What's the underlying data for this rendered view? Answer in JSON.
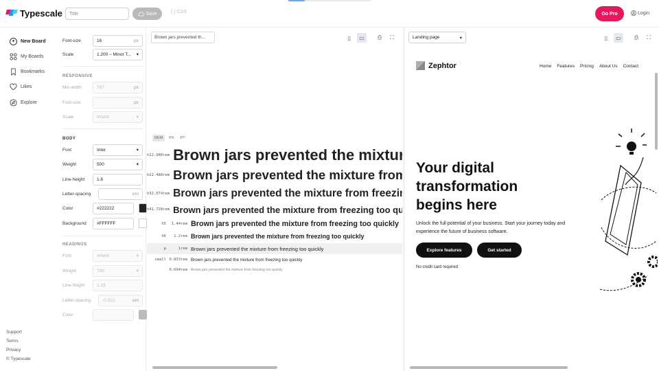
{
  "topbar": {
    "app_name": "Typescale",
    "title_placeholder": "Title",
    "save_label": "Save",
    "css_label": "CSS",
    "gopro_label": "Go Pro",
    "login_label": "Login",
    "brand_color": "#e5185e"
  },
  "sidenav": {
    "items": [
      {
        "label": "New Board",
        "icon": "plus-circle-icon"
      },
      {
        "label": "My Boards",
        "icon": "grid-icon"
      },
      {
        "label": "Bookmarks",
        "icon": "bookmark-icon"
      },
      {
        "label": "Likes",
        "icon": "heart-icon"
      },
      {
        "label": "Explore",
        "icon": "compass-icon"
      }
    ],
    "footer": [
      "Support",
      "Terms",
      "Privacy",
      "© Typescale"
    ]
  },
  "settings": {
    "font_size": {
      "label": "Font-size",
      "value": "16",
      "unit": "px"
    },
    "scale": {
      "label": "Scale",
      "value": "1.200 – Minor T..."
    },
    "responsive": {
      "heading": "RESPONSIVE",
      "min_width": {
        "label": "Min-width",
        "value": "767",
        "unit": "px"
      },
      "font_size": {
        "label": "Font-size",
        "value": "",
        "unit": "px"
      },
      "scale": {
        "label": "Scale",
        "value": "Inherit"
      }
    },
    "body": {
      "heading": "BODY",
      "font": {
        "label": "Font",
        "value": "Inter"
      },
      "weight": {
        "label": "Weight",
        "value": "500"
      },
      "line_height": {
        "label": "Line-height",
        "value": "1.6"
      },
      "letter_spacing": {
        "label": "Letter-spacing",
        "value": "",
        "unit": "em"
      },
      "color": {
        "label": "Color",
        "value": "#222222"
      },
      "background": {
        "label": "Background",
        "value": "#FFFFFF"
      }
    },
    "headings": {
      "heading": "HEADINGS",
      "font": {
        "label": "Font",
        "value": "Inherit"
      },
      "weight": {
        "label": "Weight",
        "value": "700"
      },
      "line_height": {
        "label": "Line-height",
        "value": "1.15"
      },
      "letter_spacing": {
        "label": "Letter-spacing",
        "value": "-0.022",
        "unit": "em"
      },
      "color": {
        "label": "Color",
        "value": ""
      }
    }
  },
  "preview": {
    "sample_text": "Brown jars prevented th...",
    "unit_tabs": [
      "REM",
      "PX",
      "PT"
    ],
    "active_unit": "REM",
    "rows": [
      {
        "tag": "h1",
        "rem": "2.986rem",
        "text": "Brown jars prevented the mixture from freezing too quickly"
      },
      {
        "tag": "h2",
        "rem": "2.488rem",
        "text": "Brown jars prevented the mixture from freezing too quickly"
      },
      {
        "tag": "h3",
        "rem": "2.074rem",
        "text": "Brown jars prevented the mixture from freezing too quickly"
      },
      {
        "tag": "h4",
        "rem": "1.728rem",
        "text": "Brown jars prevented the mixture from freezing too quickly"
      },
      {
        "tag": "h5",
        "rem": "1.44rem",
        "text": "Brown jars prevented the mixture from freezing too quickly"
      },
      {
        "tag": "h6",
        "rem": "1.2rem",
        "text": "Brown jars prevented the mixture from freezing too quickly"
      },
      {
        "tag": "p",
        "rem": "1rem",
        "text": "Brown jars prevented the mixture from freezing too quickly"
      },
      {
        "tag": "small",
        "rem": "0.833rem",
        "text": "Brown jars prevented the mixture from freezing too quickly"
      },
      {
        "tag": "",
        "rem": "0.694rem",
        "text": "Brown jars prevented the mixture from freezing too quickly"
      }
    ]
  },
  "site": {
    "page_select": "Landing page",
    "logo": "Zephtor",
    "nav": [
      "Home",
      "Features",
      "Pricing",
      "About Us",
      "Contact"
    ],
    "hero_title": "Your digital transformation begins here",
    "hero_sub": "Unlock the full potential of your business. Start your journey today and experience the future of business software.",
    "btn_primary": "Explore features",
    "btn_secondary": "Get started",
    "note": "No credit card required"
  }
}
